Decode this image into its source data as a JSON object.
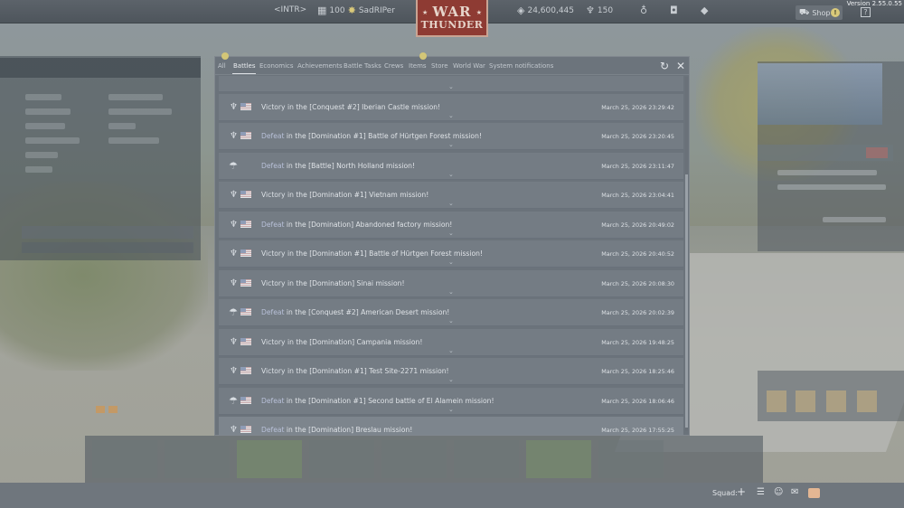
{
  "topbar": {
    "intr_label": "<INTR>",
    "player_level": "100",
    "player_name": "SadRIPer",
    "silver_lions": "24,600,445",
    "golden_eagles": "150",
    "shop_label": "Shop",
    "shop_badge": "!",
    "help_label": "?",
    "version": "Version 2.55.0.55"
  },
  "logo": {
    "line1": "WAR",
    "line2": "THUNDER"
  },
  "modal": {
    "tabs": [
      {
        "label": "All",
        "active": false,
        "badge": true
      },
      {
        "label": "Battles",
        "active": true,
        "badge": false
      },
      {
        "label": "Economics",
        "active": false,
        "badge": false
      },
      {
        "label": "Achievements",
        "active": false,
        "badge": false
      },
      {
        "label": "Battle Tasks",
        "active": false,
        "badge": false
      },
      {
        "label": "Crews",
        "active": false,
        "badge": false
      },
      {
        "label": "Items",
        "active": false,
        "badge": true
      },
      {
        "label": "Store",
        "active": false,
        "badge": false
      },
      {
        "label": "World War",
        "active": false,
        "badge": false
      },
      {
        "label": "System notifications",
        "active": false,
        "badge": false
      }
    ],
    "entries": [
      {
        "icon": "trophy",
        "result": "Victory",
        "rest": " in the [Conquest #2] Iberian Castle mission!",
        "date": "March 25, 2026 23:29:42"
      },
      {
        "icon": "trophy",
        "result": "Defeat",
        "rest": " in the [Domination #1] Battle of Hürtgen Forest mission!",
        "date": "March 25, 2026 23:20:45"
      },
      {
        "icon": "parachute",
        "result": "Defeat",
        "rest": " in the [Battle] North Holland mission!",
        "date": "March 25, 2026 23:11:47"
      },
      {
        "icon": "trophy",
        "result": "Victory",
        "rest": " in the [Domination #1] Vietnam mission!",
        "date": "March 25, 2026 23:04:41"
      },
      {
        "icon": "trophy",
        "result": "Defeat",
        "rest": " in the [Domination] Abandoned factory mission!",
        "date": "March 25, 2026 20:49:02"
      },
      {
        "icon": "trophy",
        "result": "Victory",
        "rest": " in the [Domination #1] Battle of Hürtgen Forest mission!",
        "date": "March 25, 2026 20:40:52"
      },
      {
        "icon": "trophy",
        "result": "Victory",
        "rest": " in the [Domination] Sinai mission!",
        "date": "March 25, 2026 20:08:30"
      },
      {
        "icon": "parachute",
        "result": "Defeat",
        "rest": " in the [Conquest #2] American Desert mission!",
        "date": "March 25, 2026 20:02:39"
      },
      {
        "icon": "trophy",
        "result": "Victory",
        "rest": " in the [Domination] Campania mission!",
        "date": "March 25, 2026 19:48:25"
      },
      {
        "icon": "trophy",
        "result": "Victory",
        "rest": " in the [Domination #1] Test Site-2271 mission!",
        "date": "March 25, 2026 18:25:46"
      },
      {
        "icon": "parachute",
        "result": "Defeat",
        "rest": " in the [Domination #1] Second battle of El Alamein mission!",
        "date": "March 25, 2026 18:06:46"
      },
      {
        "icon": "trophy",
        "result": "Defeat",
        "rest": " in the [Domination] Breslau mission!",
        "date": "March 25, 2026 17:55:25"
      }
    ]
  },
  "bottom": {
    "squad_label": "Squad:"
  },
  "colors": {
    "logo_red": "#8e3b33",
    "victory_text": "#dbe0e5",
    "defeat_text": "#b8c0d8"
  }
}
